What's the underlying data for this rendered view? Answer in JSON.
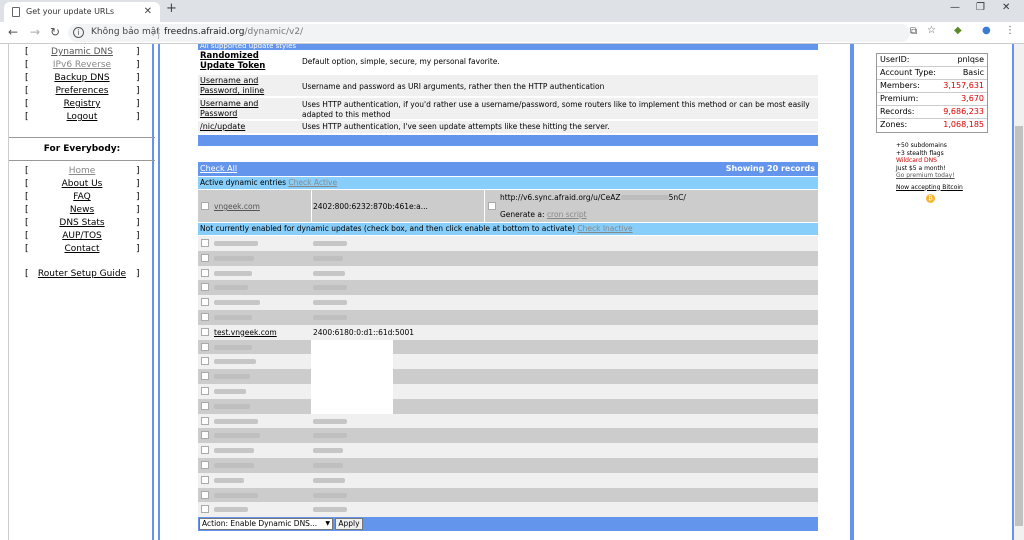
{
  "browser": {
    "tab_title": "Get your update URLs",
    "new_tab": "+",
    "security_label": "Không bảo mật",
    "url_host": "freedns.afraid.org",
    "url_path": "/dynamic/v2/"
  },
  "left_nav": {
    "top_items": [
      "Dynamic DNS",
      "IPv6 Reverse",
      "Backup DNS",
      "Preferences",
      "Registry",
      "Logout"
    ],
    "for_everybody_heading": "For Everybody:",
    "everybody_items": [
      "Home",
      "About Us",
      "FAQ",
      "News",
      "DNS Stats",
      "AUP/TOS",
      "Contact"
    ],
    "router_setup": "Router Setup Guide"
  },
  "styles": {
    "header_partial": "All supported update styles",
    "rows": [
      {
        "name": "Randomized Update Token",
        "desc": "Default option, simple, secure, my personal favorite."
      },
      {
        "name": "Username and Password, inline",
        "desc": "Username and password as URI arguments, rather then the HTTP authentication"
      },
      {
        "name": "Username and Password",
        "desc": "Uses HTTP authentication, if you'd rather use a username/password, some routers like to implement this method or can be most easily adapted to this method"
      },
      {
        "name": "/nic/update",
        "desc": "Uses HTTP authentication, I've seen update attempts like these hitting the server."
      }
    ]
  },
  "records": {
    "check_all": "Check All",
    "showing": "Showing 20 records",
    "active_label": "Active dynamic entries",
    "check_active": "Check Active",
    "active_entry": {
      "host": "vngeek.com",
      "ip": "2402:800:6232:870b:461e:a...",
      "url_prefix": "http://v6.sync.afraid.org/u/CeAZ",
      "url_suffix": "5nC/",
      "generate_label": "Generate a:",
      "cron_script": "cron script"
    },
    "inactive_label": "Not currently enabled for dynamic updates (check box, and then click enable at bottom to activate)",
    "check_inactive": "Check Inactive",
    "inactive_entries": [
      {
        "host": "",
        "ip": ""
      },
      {
        "host": "",
        "ip": ""
      },
      {
        "host": "",
        "ip": ""
      },
      {
        "host": "",
        "ip": ""
      },
      {
        "host": "",
        "ip": ""
      },
      {
        "host": "",
        "ip": ""
      },
      {
        "host": "test.vngeek.com",
        "ip": "2400:6180:0:d1::61d:5001"
      },
      {
        "host": "",
        "ip": ""
      },
      {
        "host": "",
        "ip": ""
      },
      {
        "host": "",
        "ip": ""
      },
      {
        "host": "",
        "ip": ""
      },
      {
        "host": "",
        "ip": ""
      },
      {
        "host": "",
        "ip": ""
      },
      {
        "host": "",
        "ip": ""
      },
      {
        "host": "",
        "ip": ""
      },
      {
        "host": "",
        "ip": ""
      },
      {
        "host": "",
        "ip": ""
      },
      {
        "host": "",
        "ip": ""
      },
      {
        "host": "",
        "ip": ""
      }
    ],
    "action_select": "Action: Enable Dynamic DNS...",
    "apply": "Apply"
  },
  "account": {
    "rows": [
      {
        "label": "UserID:",
        "value": "pnlqse"
      },
      {
        "label": "Account Type:",
        "value": "Basic"
      },
      {
        "label": "Members:",
        "value": "3,157,631"
      },
      {
        "label": "Premium:",
        "value": "3,670"
      },
      {
        "label": "Records:",
        "value": "9,686,233"
      },
      {
        "label": "Zones:",
        "value": "1,068,185"
      }
    ]
  },
  "promo": {
    "line1": "+50 subdomains",
    "line2": "+3 stealth flags",
    "line3": "Wildcard DNS",
    "line4": "Just $5 a month!",
    "link": "Go premium today!",
    "bitcoin": "Now accepting Bitcoin"
  },
  "colors": {
    "accent": "#6495ed",
    "cyan": "#87cefa",
    "red": "#dd0000"
  }
}
